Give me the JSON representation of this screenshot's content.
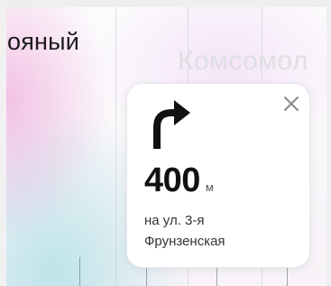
{
  "map": {
    "street_label_left": "ояный",
    "street_label_right": "Комсомол"
  },
  "maneuver": {
    "icon": "turn-right-arrow-icon",
    "close_icon": "close-icon",
    "distance_value": "400",
    "distance_unit": "м",
    "street_line_1": "на ул. 3-я",
    "street_line_2": "Фрунзенская"
  },
  "colors": {
    "arrow": "#111111",
    "card_background": "#ffffff",
    "close_icon": "#8a8a8a"
  }
}
